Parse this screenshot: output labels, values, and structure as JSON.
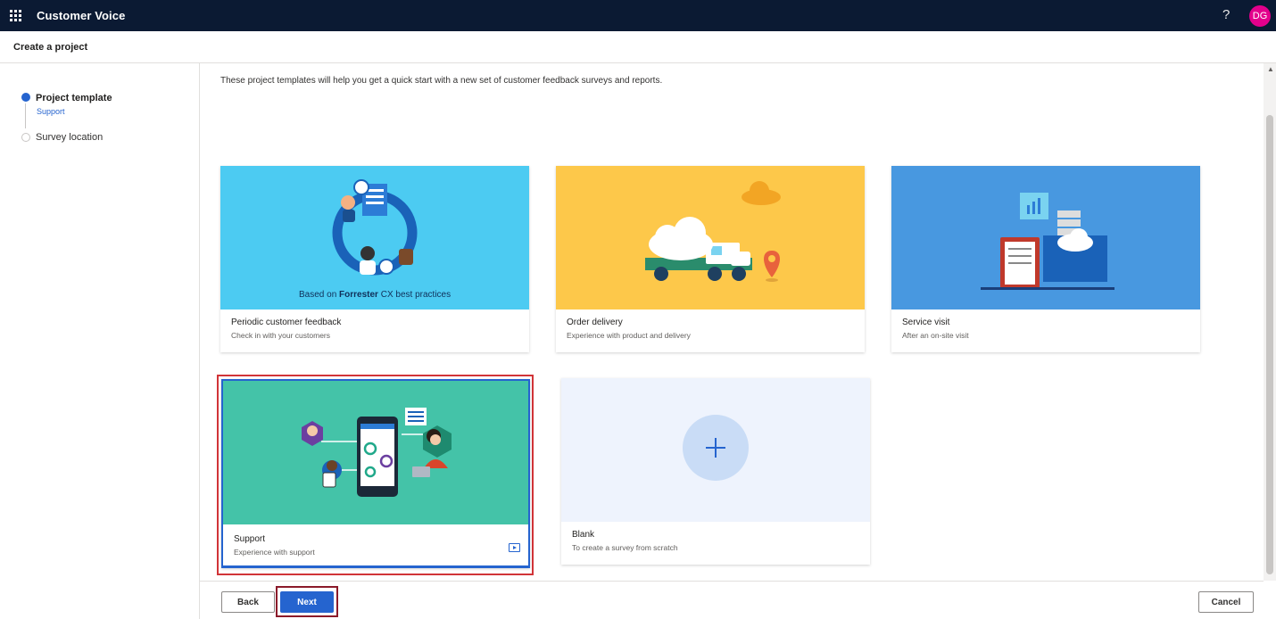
{
  "app": {
    "title": "Customer Voice",
    "help": "?",
    "avatar_initials": "DG"
  },
  "page": {
    "title": "Create a project"
  },
  "steps": [
    {
      "label": "Project template",
      "sublabel": "Support"
    },
    {
      "label": "Survey location"
    }
  ],
  "intro": "These project templates will help you get a quick start with a new set of customer feedback surveys and reports.",
  "templates": [
    {
      "title": "Periodic customer feedback",
      "desc": "Check in with your customers",
      "banner_text_before": "Based on ",
      "banner_text_bold": "Forrester",
      "banner_text_after": " CX best practices",
      "color": "#4ccbf2"
    },
    {
      "title": "Order delivery",
      "desc": "Experience with product and delivery",
      "color": "#fdc84a"
    },
    {
      "title": "Service visit",
      "desc": "After an on-site visit",
      "color": "#4898e0"
    },
    {
      "title": "Support",
      "desc": "Experience with support",
      "color": "#44c3a8",
      "selected": true
    },
    {
      "title": "Blank",
      "desc": "To create a survey from scratch",
      "color": "#eef3fd"
    }
  ],
  "buttons": {
    "back": "Back",
    "next": "Next",
    "cancel": "Cancel"
  },
  "colors": {
    "accent": "#2564cf",
    "topbar": "#0b1a33",
    "avatar": "#e3008c",
    "highlight": "#d13438"
  }
}
